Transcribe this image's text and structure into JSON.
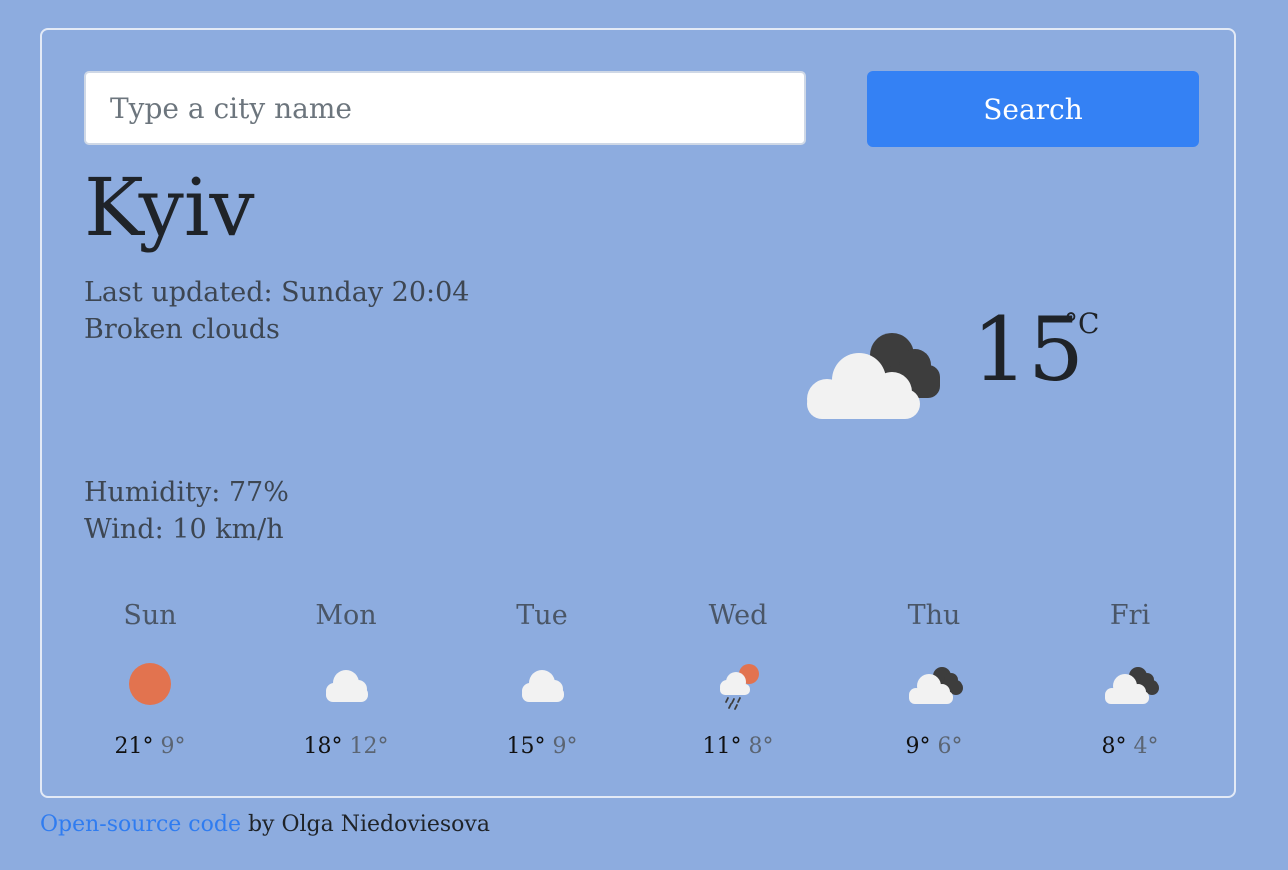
{
  "search": {
    "placeholder": "Type a city name",
    "value": "",
    "button_label": "Search"
  },
  "current": {
    "city": "Kyiv",
    "last_updated": "Last updated: Sunday 20:04",
    "description": "Broken clouds",
    "humidity": "Humidity: 77%",
    "wind": "Wind: 10 km/h",
    "temperature": "15",
    "unit": "°C",
    "icon": "broken-clouds-icon"
  },
  "forecast": [
    {
      "day": "Sun",
      "max": "21°",
      "min": "9°",
      "icon": "sun-icon"
    },
    {
      "day": "Mon",
      "max": "18°",
      "min": "12°",
      "icon": "cloud-icon"
    },
    {
      "day": "Tue",
      "max": "15°",
      "min": "9°",
      "icon": "cloud-icon"
    },
    {
      "day": "Wed",
      "max": "11°",
      "min": "8°",
      "icon": "rain-sun-icon"
    },
    {
      "day": "Thu",
      "max": "9°",
      "min": "6°",
      "icon": "broken-clouds-icon"
    },
    {
      "day": "Fri",
      "max": "8°",
      "min": "4°",
      "icon": "broken-clouds-icon"
    }
  ],
  "footer": {
    "link_text": "Open-source code",
    "by_text": " by Olga Niedoviesova"
  },
  "colors": {
    "background": "#8dacdf",
    "accent": "#3481f4",
    "sun": "#e2734f",
    "cloud_light": "#f2f2f2",
    "cloud_dark": "#3d3d3d"
  }
}
